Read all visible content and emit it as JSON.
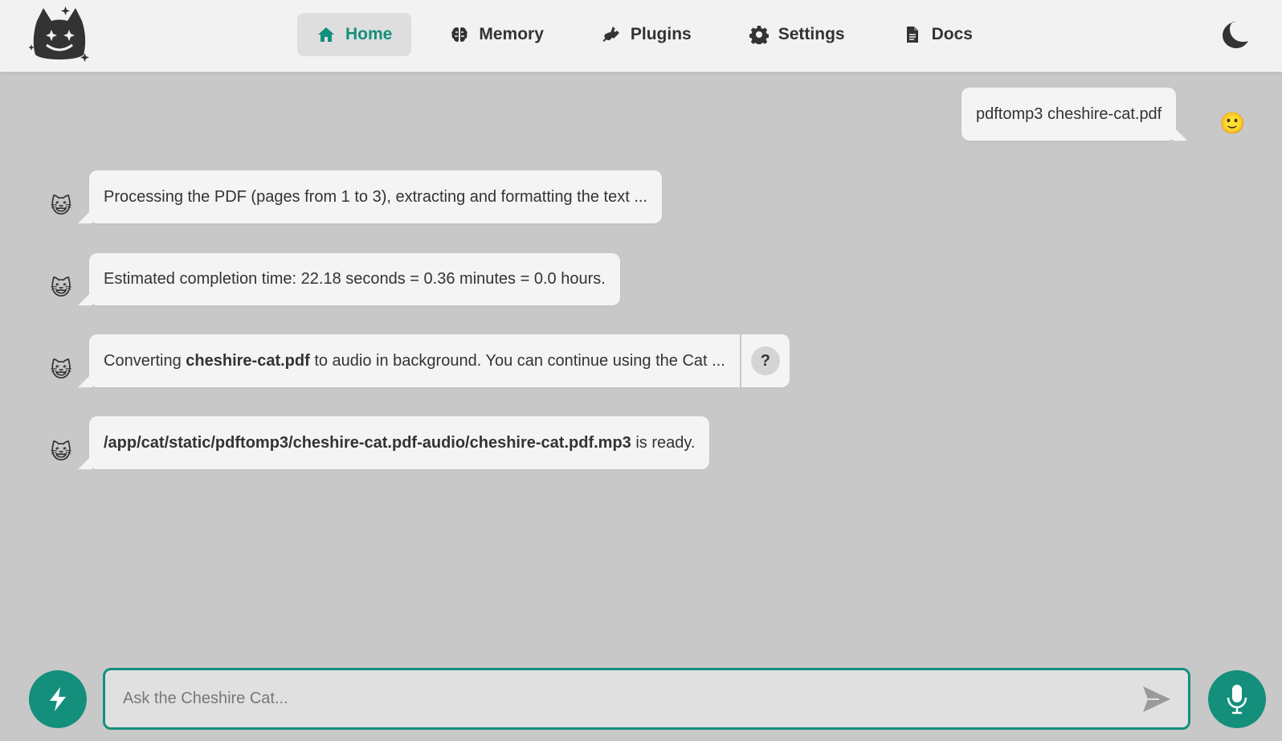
{
  "colors": {
    "accent": "#148f7c",
    "background": "#c8c8c8",
    "bubble": "#f4f4f4"
  },
  "nav": {
    "items": [
      {
        "label": "Home",
        "icon": "home-icon",
        "active": true
      },
      {
        "label": "Memory",
        "icon": "brain-icon",
        "active": false
      },
      {
        "label": "Plugins",
        "icon": "plug-icon",
        "active": false
      },
      {
        "label": "Settings",
        "icon": "gear-icon",
        "active": false
      },
      {
        "label": "Docs",
        "icon": "document-icon",
        "active": false
      }
    ],
    "theme_icon": "moon-icon"
  },
  "messages": {
    "user_1": {
      "text": "pdftomp3 cheshire-cat.pdf",
      "avatar": "🙂"
    },
    "cat_1": {
      "text": "Processing the PDF (pages from 1 to 3), extracting and formatting the text ...",
      "avatar": "😺"
    },
    "cat_2": {
      "text": "Estimated completion time: 22.18 seconds = 0.36 minutes = 0.0 hours.",
      "avatar": "😺"
    },
    "cat_3": {
      "prefix": "Converting ",
      "bold": "cheshire-cat.pdf",
      "suffix": " to audio in background. You can continue using the Cat ...",
      "avatar": "😺",
      "why_label": "?"
    },
    "cat_4": {
      "bold": "/app/cat/static/pdftomp3/cheshire-cat.pdf-audio/cheshire-cat.pdf.mp3",
      "suffix": " is ready.",
      "avatar": "😺"
    }
  },
  "input": {
    "placeholder": "Ask the Cheshire Cat...",
    "value": ""
  }
}
